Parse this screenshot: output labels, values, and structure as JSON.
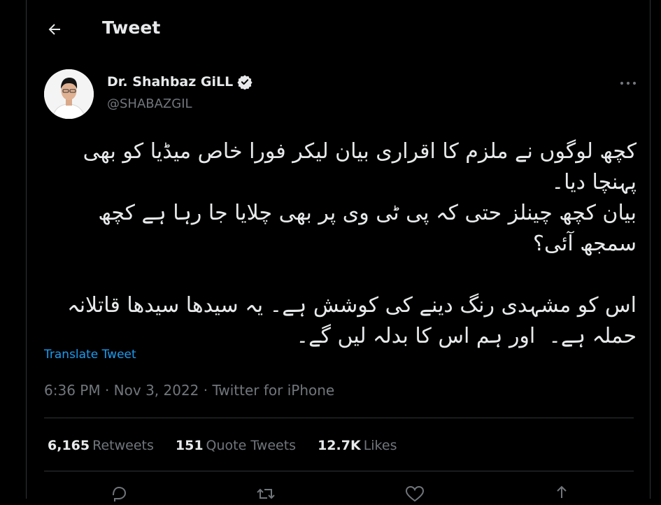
{
  "header": {
    "title": "Tweet"
  },
  "author": {
    "name": "Dr. Shahbaz GiLL",
    "handle": "@SHABAZGIL"
  },
  "tweet": {
    "text": "کچھ لوگوں نے ملزم کا اقراری بیان لیکر فورا خاص میڈیا کو بھی پہنچا دیا۔\nبیان کچھ چینلز حتی کہ پی ٹی وی پر بھی چلایا جا رہا ہے کچھ سمجھ آئی؟\n\nاس کو مشہدی رنگ دینے کی کوشش ہے۔ یہ سیدھا سیدھا قاتلانہ حملہ ہے۔  اور ہم اس کا بدلہ لیں گے۔",
    "translate_label": "Translate Tweet",
    "time": "6:36 PM",
    "date": "Nov 3, 2022",
    "source": "Twitter for iPhone",
    "separator": " · "
  },
  "stats": {
    "retweets": {
      "count": "6,165",
      "label": "Retweets"
    },
    "quotes": {
      "count": "151",
      "label": "Quote Tweets"
    },
    "likes": {
      "count": "12.7K",
      "label": "Likes"
    }
  },
  "icons": {
    "back": "arrow-left-icon",
    "verified": "verified-badge-icon",
    "more": "more-horizontal-icon",
    "reply": "reply-icon",
    "retweet": "retweet-icon",
    "like": "heart-icon",
    "share": "share-icon"
  },
  "colors": {
    "background": "#000000",
    "text": "#e7e9ea",
    "secondary": "#71767b",
    "link": "#1d9bf0",
    "border": "#2f3336"
  }
}
